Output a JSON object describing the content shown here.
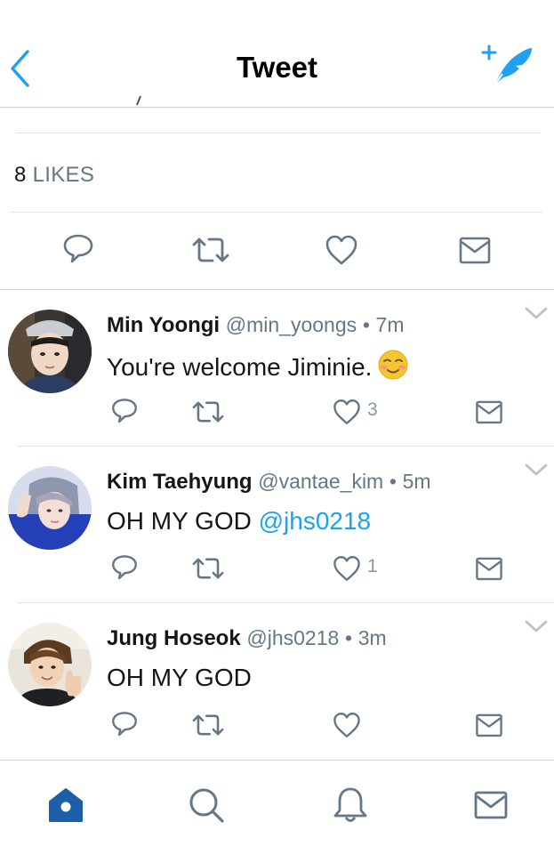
{
  "header": {
    "title": "Tweet"
  },
  "tweet": {
    "likes_count": "8",
    "likes_label": "LIKES"
  },
  "replies": [
    {
      "name": "Min Yoongi",
      "handle": "@min_yoongs",
      "dot": "•",
      "time": "7m",
      "text": "You're welcome Jiminie.",
      "mention": "",
      "emoji": "smiling-face-icon",
      "like_count": "3"
    },
    {
      "name": "Kim Taehyung",
      "handle": "@vantae_kim",
      "dot": "•",
      "time": "5m",
      "text": "OH MY GOD",
      "mention": "@jhs0218",
      "like_count": "1"
    },
    {
      "name": "Jung Hoseok",
      "handle": "@jhs0218",
      "dot": "•",
      "time": "3m",
      "text": "OH MY GOD",
      "mention": "",
      "like_count": ""
    }
  ],
  "icons": {
    "back": "chevron-left-icon",
    "compose": "compose-quill-icon",
    "reply": "reply-bubble-icon",
    "retweet": "retweet-icon",
    "like": "heart-icon",
    "dm": "envelope-icon",
    "more": "chevron-down-icon",
    "tab_home": "home-icon",
    "tab_search": "search-icon",
    "tab_notifications": "bell-icon",
    "tab_messages": "envelope-icon"
  },
  "colors": {
    "accent": "#1da1f2",
    "active_tab": "#1b5fa8",
    "icon": "#657786",
    "text": "#14171a",
    "secondary_text": "#657786",
    "divider": "#dfe3e6"
  }
}
